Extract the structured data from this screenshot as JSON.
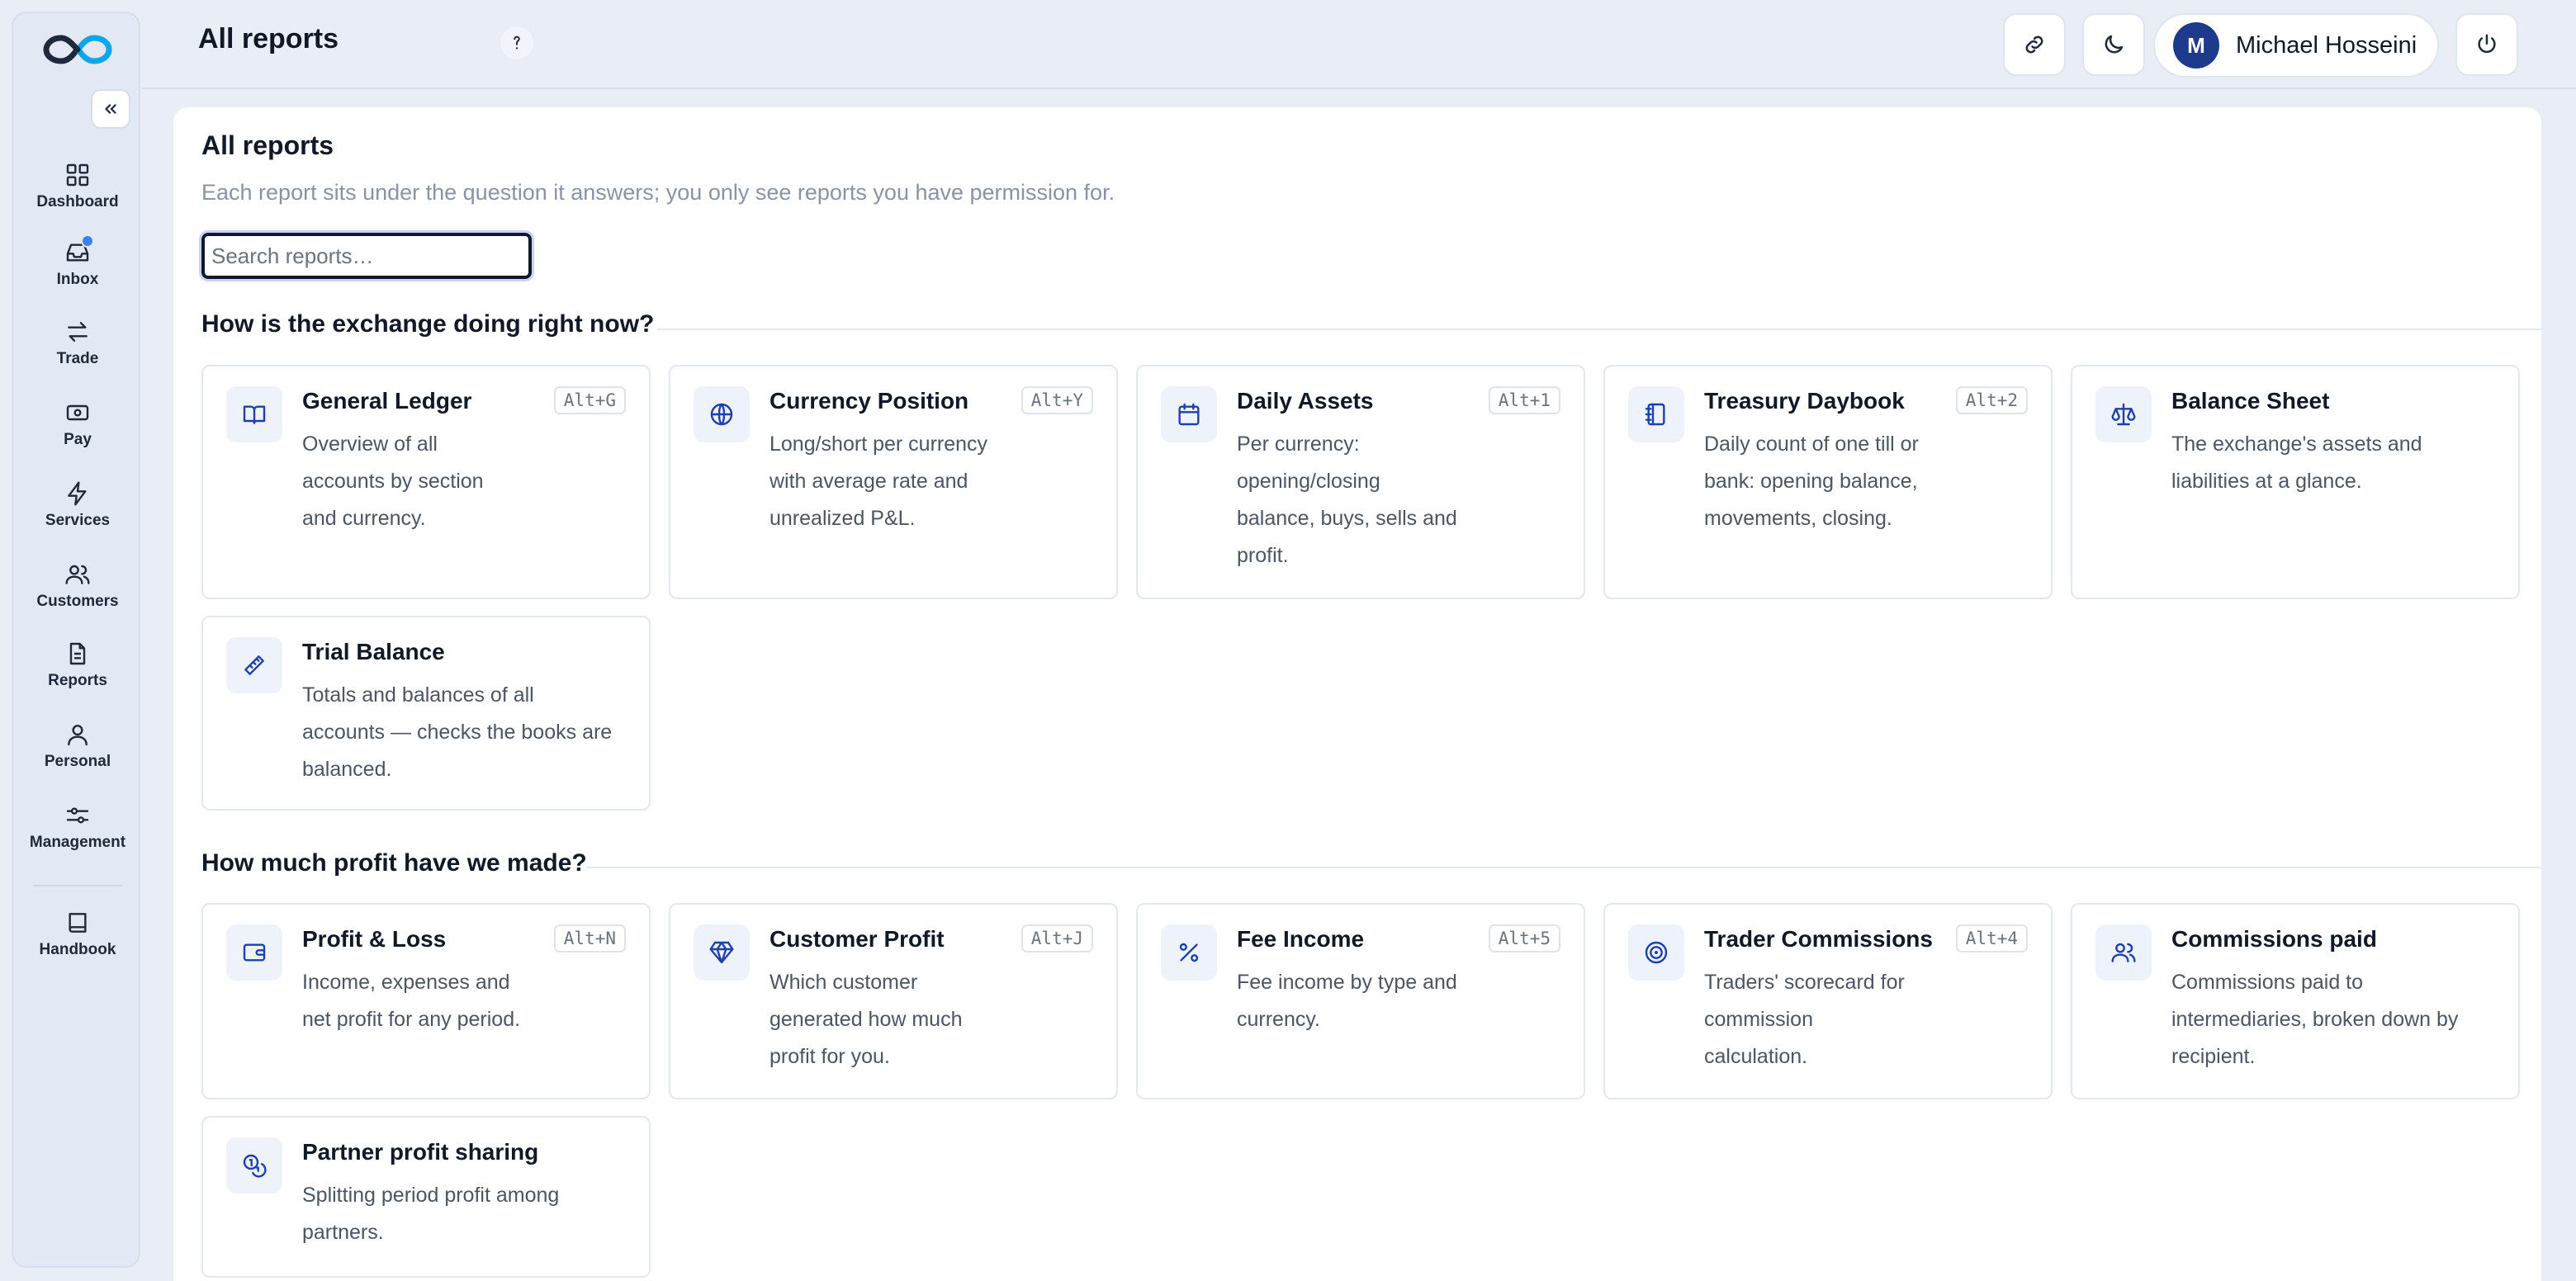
{
  "header": {
    "title": "All reports",
    "user_initial": "M",
    "user_name": "Michael Hosseini"
  },
  "sidebar": {
    "items": [
      {
        "label": "Dashboard",
        "icon": "dashboard-icon"
      },
      {
        "label": "Inbox",
        "icon": "inbox-icon"
      },
      {
        "label": "Trade",
        "icon": "swap-arrows-icon"
      },
      {
        "label": "Pay",
        "icon": "banknote-icon"
      },
      {
        "label": "Services",
        "icon": "lightning-icon"
      },
      {
        "label": "Customers",
        "icon": "users-icon"
      },
      {
        "label": "Reports",
        "icon": "file-text-icon"
      },
      {
        "label": "Personal",
        "icon": "user-icon"
      },
      {
        "label": "Management",
        "icon": "sliders-icon"
      },
      {
        "label": "Handbook",
        "icon": "book-icon"
      }
    ]
  },
  "main": {
    "title": "All reports",
    "subtitle": "Each report sits under the question it answers; you only see reports you have permission for.",
    "search_placeholder": "Search reports…",
    "sections": [
      {
        "title": "How is the exchange doing right now?",
        "cards": [
          {
            "title": "General Ledger",
            "shortcut": "Alt+G",
            "icon": "book-open-icon",
            "desc": [
              "Overview of all",
              "accounts by section",
              "and currency."
            ]
          },
          {
            "title": "Currency Position",
            "shortcut": "Alt+Y",
            "icon": "globe-icon",
            "desc": [
              "Long/short per currency",
              "with average rate and",
              "unrealized P&L."
            ]
          },
          {
            "title": "Daily Assets",
            "shortcut": "Alt+1",
            "icon": "calendar-icon",
            "desc": [
              "Per currency:",
              "opening/closing",
              "balance, buys, sells and",
              "profit."
            ]
          },
          {
            "title": "Treasury Daybook",
            "shortcut": "Alt+2",
            "icon": "notebook-icon",
            "desc": [
              "Daily count of one till or",
              "bank: opening balance,",
              "movements, closing."
            ]
          },
          {
            "title": "Balance Sheet",
            "shortcut": "",
            "icon": "scale-icon",
            "desc": [
              "The exchange's assets and",
              "liabilities at a glance."
            ]
          },
          {
            "title": "Trial Balance",
            "shortcut": "",
            "icon": "ruler-icon",
            "desc": [
              "Totals and balances of all",
              "accounts — checks the books are",
              "balanced."
            ]
          }
        ]
      },
      {
        "title": "How much profit have we made?",
        "cards": [
          {
            "title": "Profit & Loss",
            "shortcut": "Alt+N",
            "icon": "wallet-icon",
            "desc": [
              "Income, expenses and",
              "net profit for any period."
            ]
          },
          {
            "title": "Customer Profit",
            "shortcut": "Alt+J",
            "icon": "gem-icon",
            "desc": [
              "Which customer",
              "generated how much",
              "profit for you."
            ]
          },
          {
            "title": "Fee Income",
            "shortcut": "Alt+5",
            "icon": "percent-icon",
            "desc": [
              "Fee income by type and",
              "currency."
            ]
          },
          {
            "title": "Trader Commissions",
            "shortcut": "Alt+4",
            "icon": "target-icon",
            "desc": [
              "Traders' scorecard for",
              "commission",
              "calculation."
            ]
          },
          {
            "title": "Commissions paid",
            "shortcut": "",
            "icon": "users-icon",
            "desc": [
              "Commissions paid to",
              "intermediaries, broken down by",
              "recipient."
            ]
          },
          {
            "title": "Partner profit sharing",
            "shortcut": "",
            "icon": "coins-icon",
            "desc": [
              "Splitting period profit among",
              "partners."
            ]
          }
        ]
      }
    ]
  }
}
